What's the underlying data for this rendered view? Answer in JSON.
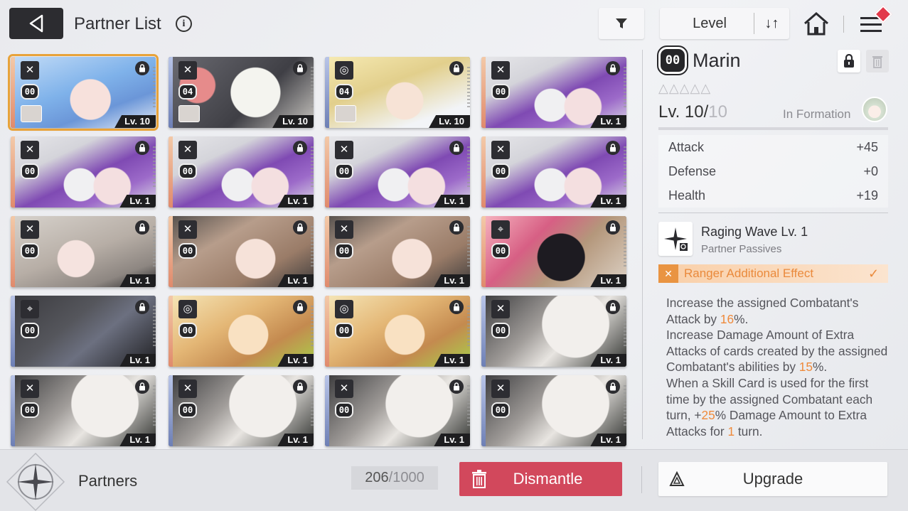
{
  "header": {
    "title": "Partner List",
    "info_icon": "i",
    "sort_label": "Level",
    "sort_toggle": "↓↑"
  },
  "cards": [
    {
      "grade": "00",
      "level": "Lv. 10",
      "art": "art-bluehair",
      "role": "✕",
      "stripe": "orange",
      "avatar": true,
      "selected": true
    },
    {
      "grade": "04",
      "level": "Lv. 10",
      "art": "art-white",
      "role": "✕",
      "stripe": "blue",
      "avatar": true,
      "selected": false
    },
    {
      "grade": "04",
      "level": "Lv. 10",
      "art": "art-blonde",
      "role": "◎",
      "stripe": "blue",
      "avatar": true,
      "selected": false
    },
    {
      "grade": "00",
      "level": "Lv. 1",
      "art": "art-purple",
      "role": "✕",
      "stripe": "orange",
      "avatar": false,
      "selected": false
    },
    {
      "grade": "00",
      "level": "Lv. 1",
      "art": "art-purple",
      "role": "✕",
      "stripe": "orange",
      "avatar": false,
      "selected": false
    },
    {
      "grade": "00",
      "level": "Lv. 1",
      "art": "art-purple",
      "role": "✕",
      "stripe": "orange",
      "avatar": false,
      "selected": false
    },
    {
      "grade": "00",
      "level": "Lv. 1",
      "art": "art-purple",
      "role": "✕",
      "stripe": "orange",
      "avatar": false,
      "selected": false
    },
    {
      "grade": "00",
      "level": "Lv. 1",
      "art": "art-purple",
      "role": "✕",
      "stripe": "orange",
      "avatar": false,
      "selected": false
    },
    {
      "grade": "00",
      "level": "Lv. 1",
      "art": "art-grayhair",
      "role": "✕",
      "stripe": "orange",
      "avatar": false,
      "selected": false
    },
    {
      "grade": "00",
      "level": "Lv. 1",
      "art": "art-brown",
      "role": "✕",
      "stripe": "orange",
      "avatar": false,
      "selected": false
    },
    {
      "grade": "00",
      "level": "Lv. 1",
      "art": "art-brown",
      "role": "✕",
      "stripe": "orange",
      "avatar": false,
      "selected": false
    },
    {
      "grade": "00",
      "level": "Lv. 1",
      "art": "art-blob",
      "role": "⌖",
      "stripe": "orange",
      "avatar": false,
      "selected": false
    },
    {
      "grade": "00",
      "level": "Lv. 1",
      "art": "art-dark",
      "role": "⌖",
      "stripe": "blue",
      "avatar": false,
      "selected": false
    },
    {
      "grade": "00",
      "level": "Lv. 1",
      "art": "art-ginger",
      "role": "◎",
      "stripe": "orange",
      "avatar": false,
      "selected": false
    },
    {
      "grade": "00",
      "level": "Lv. 1",
      "art": "art-ginger",
      "role": "◎",
      "stripe": "orange",
      "avatar": false,
      "selected": false
    },
    {
      "grade": "00",
      "level": "Lv. 1",
      "art": "art-bunny",
      "role": "✕",
      "stripe": "blue",
      "avatar": false,
      "selected": false
    },
    {
      "grade": "00",
      "level": "Lv. 1",
      "art": "art-bunny",
      "role": "✕",
      "stripe": "blue",
      "avatar": false,
      "selected": false
    },
    {
      "grade": "00",
      "level": "Lv. 1",
      "art": "art-bunny",
      "role": "✕",
      "stripe": "blue",
      "avatar": false,
      "selected": false
    },
    {
      "grade": "00",
      "level": "Lv. 1",
      "art": "art-bunny",
      "role": "✕",
      "stripe": "blue",
      "avatar": false,
      "selected": false
    },
    {
      "grade": "00",
      "level": "Lv. 1",
      "art": "art-bunny",
      "role": "✕",
      "stripe": "blue",
      "avatar": false,
      "selected": false
    }
  ],
  "detail": {
    "grade": "00",
    "name": "Marin",
    "stars": "△△△△△",
    "level_prefix": "Lv. 10/",
    "level_max": "10",
    "formation": "In Formation",
    "stats": [
      {
        "label": "Attack",
        "value": "+45"
      },
      {
        "label": "Defense",
        "value": "+0"
      },
      {
        "label": "Health",
        "value": "+19"
      }
    ],
    "skill_name": "Raging Wave Lv. 1",
    "skill_type": "Partner Passives",
    "effect_label": "Ranger Additional Effect",
    "effect_check": "✓",
    "desc": {
      "p1": "Increase the assigned Combatant's Attack by ",
      "v1": "16",
      "p2": "%.",
      "p3": "Increase Damage Amount of Extra Attacks of cards created by the assigned Combatant's abilities by ",
      "v2": "15",
      "p4": "%.",
      "p5": "When a Skill Card is used for the first time by the assigned Combatant each turn, +",
      "v3": "25",
      "p6": "% Damage Amount to Extra Attacks for ",
      "v4": "1",
      "p7": " turn."
    }
  },
  "footer": {
    "partners_label": "Partners",
    "capacity_current": "206",
    "capacity_sep": " / ",
    "capacity_max": "1000",
    "dismantle_label": "Dismantle",
    "upgrade_label": "Upgrade"
  },
  "colors": {
    "accent_orange": "#ef8a3b",
    "dismantle_red": "#d2485c",
    "selected_outline": "#e8a33a"
  }
}
